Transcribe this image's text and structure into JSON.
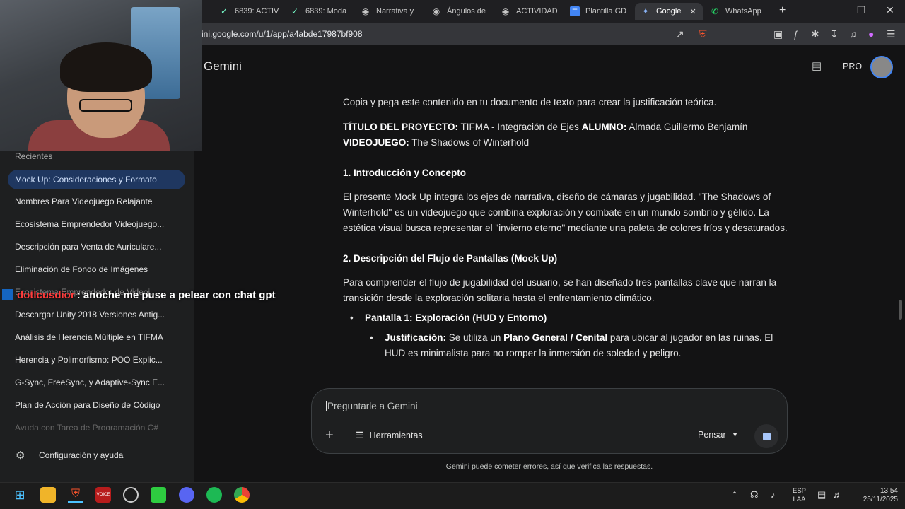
{
  "tabs": [
    {
      "label": "6839: ACTIV",
      "icon": "task-icon"
    },
    {
      "label": "6839: Moda",
      "icon": "task-icon"
    },
    {
      "label": "Narrativa y",
      "icon": "globe-icon"
    },
    {
      "label": "Ángulos de",
      "icon": "globe-icon"
    },
    {
      "label": "ACTIVIDAD",
      "icon": "globe-icon"
    },
    {
      "label": "Plantilla GD",
      "icon": "docs-icon"
    },
    {
      "label": "Google",
      "icon": "gemini-icon"
    },
    {
      "label": "WhatsApp",
      "icon": "whatsapp-icon"
    }
  ],
  "url": "ini.google.com/u/1/app/a4abde17987bf908",
  "app": {
    "title": "Gemini",
    "pro_label": "PRO"
  },
  "sidebar": {
    "recent_label": "Recientes",
    "chats": [
      "Mock Up: Consideraciones y Formato",
      "Nombres Para Videojuego Relajante",
      "Ecosistema Emprendedor Videojuego...",
      "Descripción para Venta de Auriculare...",
      "Eliminación de Fondo de Imágenes",
      "Ecosistema Emprendedor de Videoj...",
      "Descargar Unity 2018 Versiones Antig...",
      "Análisis de Herencia Múltiple en TIFMA",
      "Herencia y Polimorfismo: POO Explic...",
      "G-Sync, FreeSync, y Adaptive-Sync E...",
      "Plan de Acción para Diseño de Código",
      "Ayuda con Tarea de Programación C#"
    ],
    "settings_label": "Configuración y ayuda"
  },
  "overlay": {
    "username": "dotlcusdior",
    "message": ": anoche me puse a pelear con chat gpt"
  },
  "content": {
    "intro": "Copia y pega este contenido en tu documento de texto para crear la justificación teórica.",
    "title_label": "TÍTULO DEL PROYECTO:",
    "title_value": " TIFMA - Integración de Ejes ",
    "student_label": "ALUMNO:",
    "student_value": " Almada Guillermo Benjamín",
    "game_label": "VIDEOJUEGO:",
    "game_value": " The Shadows of Winterhold",
    "h1": "1. Introducción y Concepto",
    "p1": "El presente Mock Up integra los ejes de narrativa, diseño de cámaras y jugabilidad. \"The Shadows of Winterhold\" es un videojuego que combina exploración y combate en un mundo sombrío y gélido. La estética visual busca representar el \"invierno eterno\" mediante una paleta de colores fríos y desaturados.",
    "h2": "2. Descripción del Flujo de Pantallas (Mock Up)",
    "p2": "Para comprender el flujo de jugabilidad del usuario, se han diseñado tres pantallas clave que narran la transición desde la exploración solitaria hasta el enfrentamiento climático.",
    "bullet1": "Pantalla 1: Exploración (HUD y Entorno)",
    "sub_label": "Justificación:",
    "sub_text1": " Se utiliza un ",
    "sub_bold": "Plano General / Cenital",
    "sub_text2": " para ubicar al jugador en las ruinas. El HUD es minimalista para no romper la inmersión de soledad y peligro."
  },
  "composer": {
    "placeholder": "Preguntarle a Gemini",
    "tools_label": "Herramientas",
    "mode_label": "Pensar"
  },
  "disclaimer": "Gemini puede cometer errores, así que verifica las respuestas.",
  "taskbar": {
    "lang": "ESP",
    "lang2": "LAA",
    "time": "13:54",
    "date": "25/11/2025",
    "voicemeeter": "VOICE"
  },
  "colors": {
    "accent": "#1f3760",
    "bg": "#131314",
    "sidebar": "#1e1f20"
  }
}
